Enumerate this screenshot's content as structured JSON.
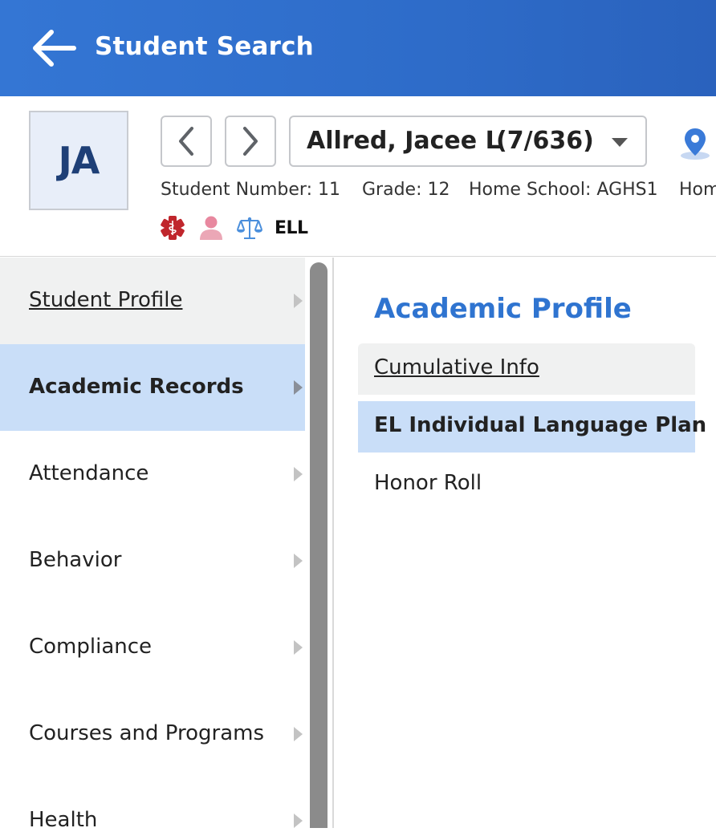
{
  "topbar": {
    "back_icon": "arrow-left-icon",
    "title": "Student Search",
    "background": "#3476d4"
  },
  "student": {
    "initials": "JA",
    "name": "Allred, Jacee L",
    "position": "(7/636)",
    "student_number": "Student Number: 11",
    "grade": "Grade: 12",
    "home_school": "Home School: AGHS1",
    "home_truncated": "Hom",
    "badges": {
      "medical_icon": "medical-alert-icon",
      "person_icon": "person-icon",
      "legal_icon": "scales-icon",
      "ell_label": "ELL"
    }
  },
  "sidebar": {
    "items": [
      {
        "label": "Student Profile"
      },
      {
        "label": "Academic Records"
      },
      {
        "label": "Attendance"
      },
      {
        "label": "Behavior"
      },
      {
        "label": "Compliance"
      },
      {
        "label": "Courses and Programs"
      },
      {
        "label": "Health"
      }
    ],
    "active_color": "#c9def8"
  },
  "content": {
    "title": "Academic Profile",
    "items": [
      {
        "label": "Cumulative Info"
      },
      {
        "label": "EL Individual Language Plan"
      },
      {
        "label": "Honor Roll"
      }
    ],
    "accent": "#2f74d0"
  }
}
